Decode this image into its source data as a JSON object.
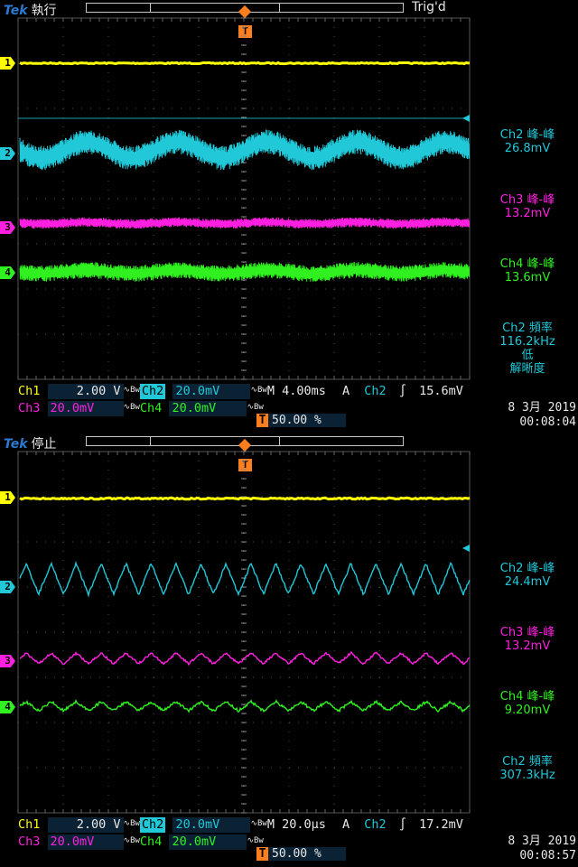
{
  "colors": {
    "ch1": "#ffff00",
    "ch2": "#20c8d8",
    "ch3": "#ff1fe0",
    "ch4": "#30f020",
    "trigger": "#ff7f1f"
  },
  "panels": [
    {
      "brand": "Tek",
      "state": "執行",
      "trigger_status": "Trig'd",
      "channel_markers": [
        "1",
        "2",
        "3",
        "4"
      ],
      "trigger_marker": "T",
      "measurements": [
        {
          "label": "Ch2 峰-峰",
          "value": "26.8mV",
          "color": "#20c8d8"
        },
        {
          "label": "Ch3 峰-峰",
          "value": "13.2mV",
          "color": "#ff1fe0"
        },
        {
          "label": "Ch4 峰-峰",
          "value": "13.6mV",
          "color": "#30f020"
        },
        {
          "label": "Ch2 頻率",
          "value": "116.2kHz",
          "extra1": "低",
          "extra2": "解晰度",
          "color": "#20c8d8"
        }
      ],
      "bottom": {
        "ch1_label": "Ch1",
        "ch1_scale": "2.00 V",
        "ch2_label": "Ch2",
        "ch2_scale": "20.0mV",
        "timebase": "M 4.00ms",
        "acq": "A",
        "trig_src": "Ch2",
        "trig_slope": "∫",
        "trig_level": "15.6mV",
        "ch3_label": "Ch3",
        "ch3_scale": "20.0mV",
        "ch4_label": "Ch4",
        "ch4_scale": "20.0mV",
        "trig_pos": "50.00 %",
        "date": "8 3月  2019",
        "time": "00:08:04"
      }
    },
    {
      "brand": "Tek",
      "state": "停止",
      "trigger_status": "",
      "channel_markers": [
        "1",
        "2",
        "3",
        "4"
      ],
      "trigger_marker": "T",
      "measurements": [
        {
          "label": "Ch2 峰-峰",
          "value": "24.4mV",
          "color": "#20c8d8"
        },
        {
          "label": "Ch3 峰-峰",
          "value": "13.2mV",
          "color": "#ff1fe0"
        },
        {
          "label": "Ch4 峰-峰",
          "value": "9.20mV",
          "color": "#30f020"
        },
        {
          "label": "Ch2 頻率",
          "value": "307.3kHz",
          "color": "#20c8d8"
        }
      ],
      "bottom": {
        "ch1_label": "Ch1",
        "ch1_scale": "2.00 V",
        "ch2_label": "Ch2",
        "ch2_scale": "20.0mV",
        "timebase": "M 20.0µs",
        "acq": "A",
        "trig_src": "Ch2",
        "trig_slope": "∫",
        "trig_level": "17.2mV",
        "ch3_label": "Ch3",
        "ch3_scale": "20.0mV",
        "ch4_label": "Ch4",
        "ch4_scale": "20.0mV",
        "trig_pos": "50.00 %",
        "date": "8 3月  2019",
        "time": "00:08:57"
      }
    }
  ]
}
